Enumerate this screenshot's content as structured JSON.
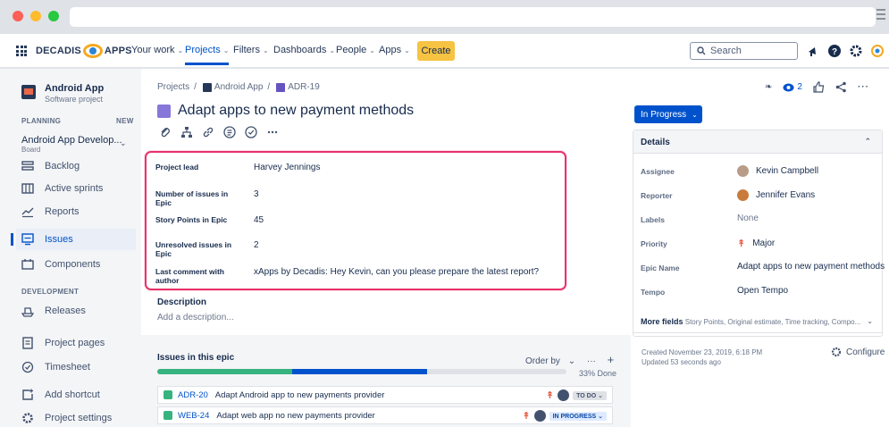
{
  "topnav": {
    "logo_left": "DECADIS",
    "logo_right": "APPS",
    "items": [
      "Your work",
      "Projects",
      "Filters",
      "Dashboards",
      "People",
      "Apps"
    ],
    "create": "Create",
    "search_placeholder": "Search"
  },
  "sidebar": {
    "project_name": "Android App",
    "project_type": "Software project",
    "planning_label": "PLANNING",
    "new_badge": "NEW",
    "board_name": "Android App Develop...",
    "board_sub": "Board",
    "items": [
      "Backlog",
      "Active sprints",
      "Reports",
      "Issues",
      "Components"
    ],
    "development_label": "DEVELOPMENT",
    "releases": "Releases",
    "bottom_items": [
      "Project pages",
      "Timesheet",
      "Add shortcut",
      "Project settings"
    ]
  },
  "breadcrumb": {
    "projects": "Projects",
    "sep": "/",
    "project": "Android App",
    "issue": "ADR-19"
  },
  "issue": {
    "title": "Adapt apps to new payment methods"
  },
  "fields": [
    {
      "label": "Project lead",
      "value": "Harvey Jennings"
    },
    {
      "label": "Number of issues in Epic",
      "value": "3"
    },
    {
      "label": "Story Points in Epic",
      "value": "45"
    },
    {
      "label": "Unresolved issues in Epic",
      "value": "2"
    },
    {
      "label": "Last comment with author",
      "value": "xApps by Decadis: Hey Kevin, can you please prepare the latest report?"
    }
  ],
  "description": {
    "label": "Description",
    "placeholder": "Add a description..."
  },
  "epic": {
    "title": "Issues in this epic",
    "order_by": "Order by",
    "progress_done": 0.33,
    "progress_inprogress": 0.33,
    "percent_label": "33% Done",
    "rows": [
      {
        "key": "ADR-20",
        "summary": "Adapt Android app to new payments provider",
        "status": "TO DO"
      },
      {
        "key": "WEB-24",
        "summary": "Adapt web app no new payments provider",
        "status": "IN PROGRESS"
      }
    ]
  },
  "right": {
    "status": "In Progress",
    "watch_count": "2",
    "details_title": "Details",
    "details": [
      {
        "label": "Assignee",
        "value": "Kevin Campbell",
        "avatar": "kevin"
      },
      {
        "label": "Reporter",
        "value": "Jennifer Evans",
        "avatar": "jen"
      },
      {
        "label": "Labels",
        "value": "None",
        "muted": true
      },
      {
        "label": "Priority",
        "value": "Major",
        "priority": true
      },
      {
        "label": "Epic Name",
        "value": "Adapt apps to new payment methods"
      },
      {
        "label": "Tempo",
        "value": "Open Tempo"
      }
    ],
    "more_fields_label": "More fields",
    "more_fields_list": "Story Points, Original estimate, Time tracking, Compo...",
    "created": "Created November 23, 2019, 6:18 PM",
    "updated": "Updated 53 seconds ago",
    "configure": "Configure"
  },
  "colors": {
    "accent": "#0052cc",
    "highlight": "#e8326b",
    "create": "#f6c342"
  }
}
